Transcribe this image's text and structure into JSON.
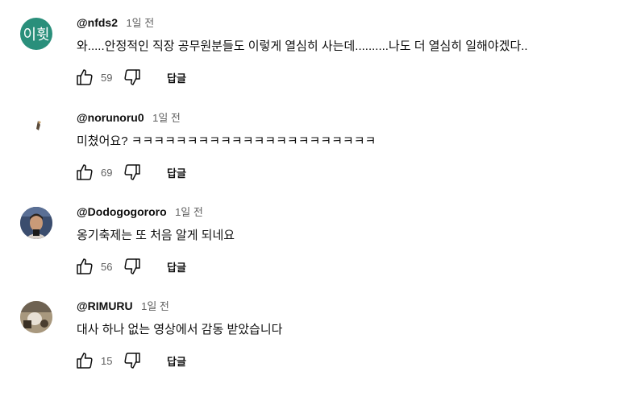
{
  "comments": [
    {
      "author": "@nfds2",
      "time": "1일 전",
      "avatar_letters": "이휫",
      "avatar_color": "#2a8f7b",
      "text": "와.....안정적인 직장 공무원분들도 이렇게 열심히 사는데..........나도 더 열심히 일해야겠다..",
      "likes": "59",
      "reply_label": "답글"
    },
    {
      "author": "@norunoru0",
      "time": "1일 전",
      "text": "미쳤어요? ㅋㅋㅋㅋㅋㅋㅋㅋㅋㅋㅋㅋㅋㅋㅋㅋㅋㅋㅋㅋㅋㅋ",
      "likes": "69",
      "reply_label": "답글"
    },
    {
      "author": "@Dodogogororo",
      "time": "1일 전",
      "text": "옹기축제는 또 처음 알게 되네요",
      "likes": "56",
      "reply_label": "답글"
    },
    {
      "author": "@RIMURU",
      "time": "1일 전",
      "text": "대사 하나 없는 영상에서 감동 받았습니다",
      "likes": "15",
      "reply_label": "답글"
    }
  ]
}
